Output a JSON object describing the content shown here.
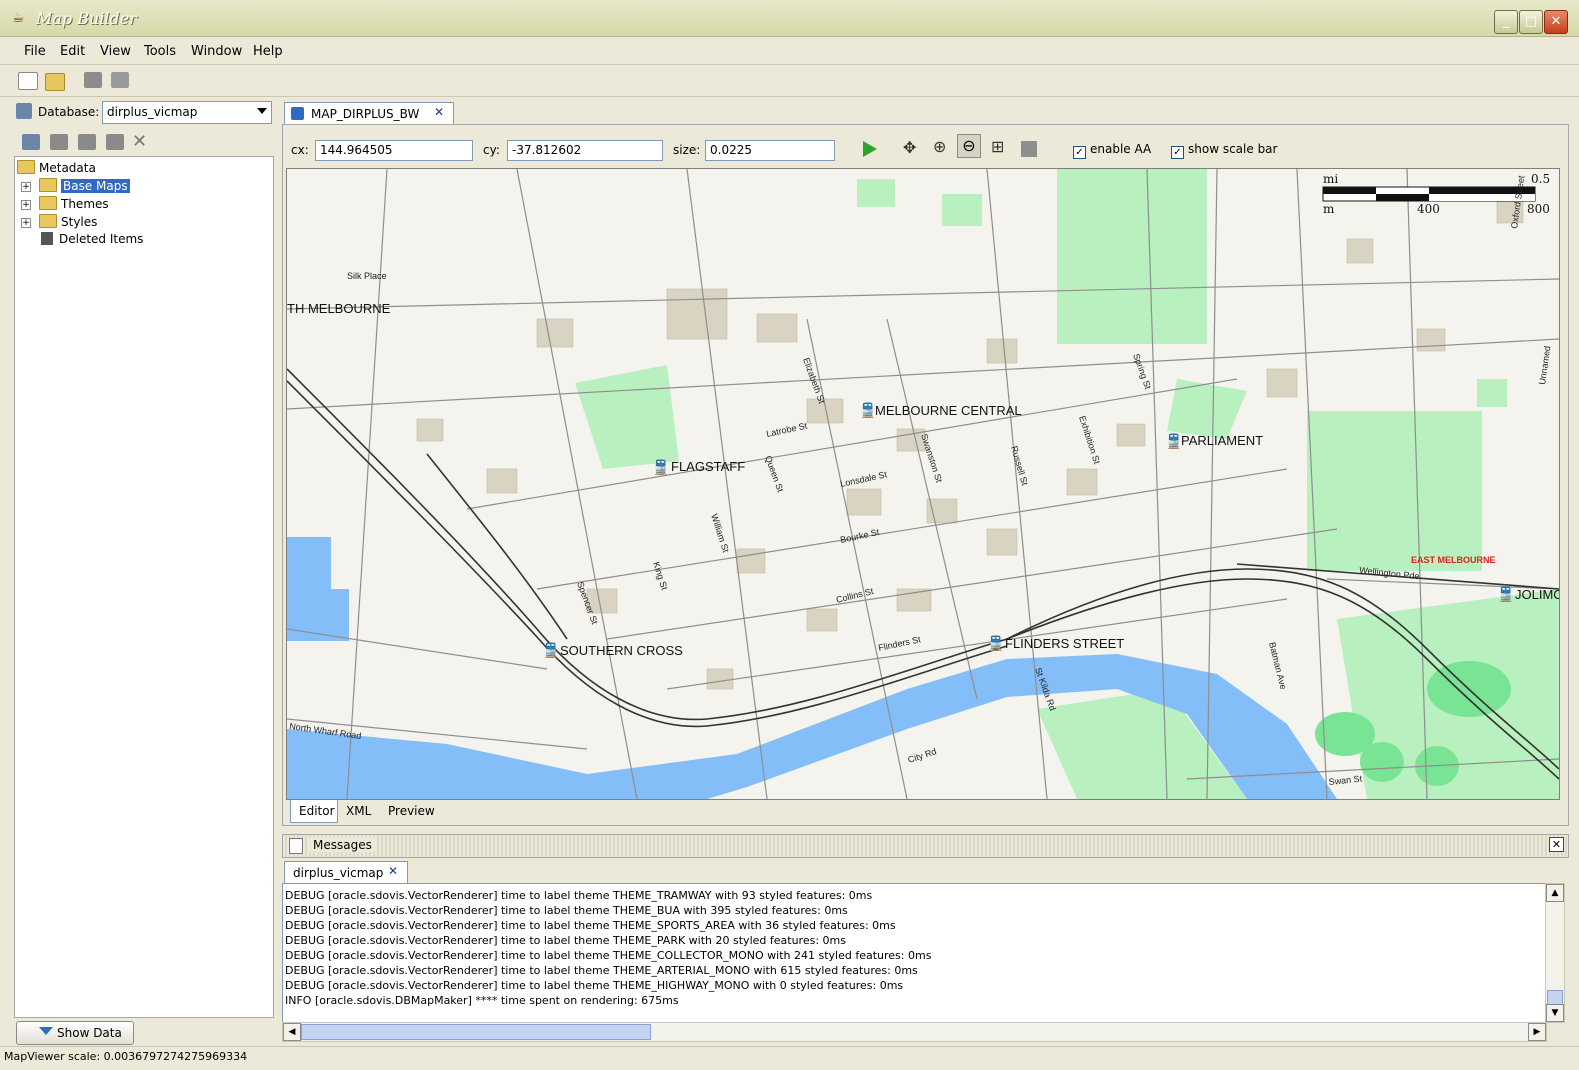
{
  "window": {
    "title": "Map Builder"
  },
  "menu": {
    "items": [
      "File",
      "Edit",
      "View",
      "Tools",
      "Window",
      "Help"
    ]
  },
  "database": {
    "label": "Database:",
    "value": "dirplus_vicmap"
  },
  "tree": {
    "root": "Metadata",
    "items": [
      "Base Maps",
      "Themes",
      "Styles",
      "Deleted Items"
    ]
  },
  "show_data_label": "Show Data",
  "status_text": "MapViewer scale: 0.0036797274275969334",
  "editor": {
    "tab_label": "MAP_DIRPLUS_BW",
    "cx_label": "cx:",
    "cx_value": "144.964505",
    "cy_label": "cy:",
    "cy_value": "-37.812602",
    "size_label": "size:",
    "size_value": "0.0225",
    "enable_aa_label": "enable AA",
    "show_scale_bar_label": "show scale bar",
    "bottom_tabs": [
      "Editor",
      "XML",
      "Preview"
    ]
  },
  "map": {
    "colors": {
      "land": "#f4f3ee",
      "park": "#b8f1bf",
      "water": "#84bef8",
      "building": "#d9d4c2",
      "road": "#8e8e8e",
      "rail": "#333333",
      "label": "#111111",
      "accent_label": "#e02020"
    },
    "scale_bar": {
      "unit_top": "mi",
      "top_value": "0.5",
      "unit_bottom": "m",
      "mid_value": "400",
      "end_value": "800"
    },
    "stations": [
      "MELBOURNE CENTRAL",
      "PARLIAMENT",
      "FLAGSTAFF",
      "SOUTHERN CROSS",
      "FLINDERS STREET",
      "JOLIMO"
    ],
    "place_labels": [
      "TH MELBOURNE",
      "EAST MELBOURNE"
    ],
    "street_labels": [
      "Silk Place",
      "Elizabeth St",
      "Latrobe St",
      "Spring St",
      "Exhibition St",
      "Swanston St",
      "Russell St",
      "Queen St",
      "Lonsdale St",
      "William St",
      "Bourke St",
      "King St",
      "Spencer St",
      "Collins St",
      "Flinders St",
      "St Kilda Rd",
      "Wellington Pde",
      "Batman Ave",
      "City Rd",
      "Swan St",
      "North Wharf Road",
      "Oxford Street",
      "Unnamed"
    ]
  },
  "messages": {
    "header": "Messages",
    "tab_label": "dirplus_vicmap",
    "lines": [
      "DEBUG [oracle.sdovis.VectorRenderer] time to label theme THEME_TRAMWAY with 93 styled features: 0ms",
      "DEBUG [oracle.sdovis.VectorRenderer] time to label theme THEME_BUA with 395 styled features: 0ms",
      "DEBUG [oracle.sdovis.VectorRenderer] time to label theme THEME_SPORTS_AREA with 36 styled features: 0ms",
      "DEBUG [oracle.sdovis.VectorRenderer] time to label theme THEME_PARK with 20 styled features: 0ms",
      "DEBUG [oracle.sdovis.VectorRenderer] time to label theme THEME_COLLECTOR_MONO with 241 styled features: 0ms",
      "DEBUG [oracle.sdovis.VectorRenderer] time to label theme THEME_ARTERIAL_MONO with 615 styled features: 0ms",
      "DEBUG [oracle.sdovis.VectorRenderer] time to label theme THEME_HIGHWAY_MONO with 0 styled features: 0ms",
      "INFO [oracle.sdovis.DBMapMaker] **** time spent on rendering: 675ms"
    ]
  }
}
